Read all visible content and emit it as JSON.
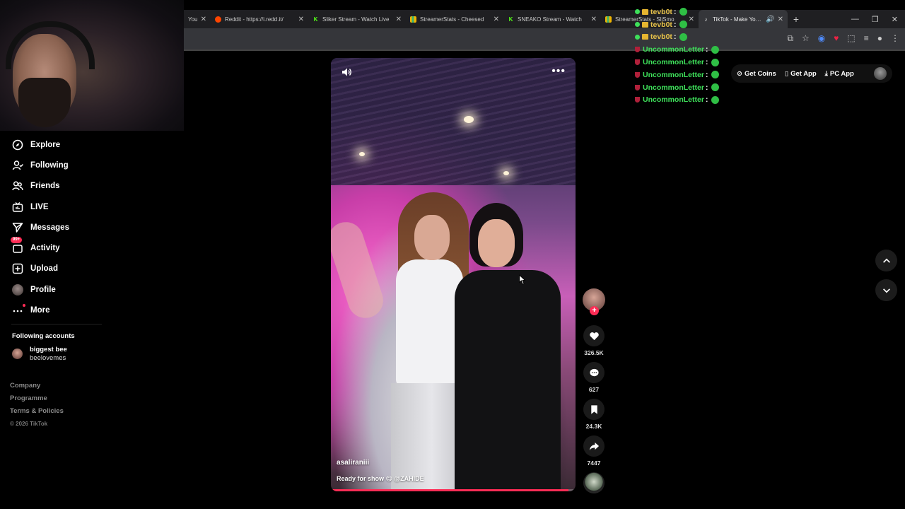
{
  "browser": {
    "tabs": [
      {
        "title": "You",
        "fav_color": "#ff0000",
        "fav_glyph": ""
      },
      {
        "title": "Reddit - https://i.redd.it/",
        "fav_color": "#ff4500",
        "fav_glyph": ""
      },
      {
        "title": "Sliker Stream - Watch Live",
        "fav_color": "#53fc18",
        "fav_glyph": "K"
      },
      {
        "title": "StreamerStats - Cheesed",
        "fav_color": "#f0b400",
        "fav_glyph": ""
      },
      {
        "title": "SNEAKO Stream - Watch",
        "fav_color": "#53fc18",
        "fav_glyph": "K"
      },
      {
        "title": "StreamerStats - SliSmo",
        "fav_color": "#f0b400",
        "fav_glyph": ""
      }
    ],
    "active_tab": "TikTok - Make Your Day"
  },
  "sidebar": {
    "items": [
      {
        "label": "Explore",
        "icon": "compass-icon"
      },
      {
        "label": "Following",
        "icon": "following-icon"
      },
      {
        "label": "Friends",
        "icon": "friends-icon"
      },
      {
        "label": "LIVE",
        "icon": "live-icon"
      },
      {
        "label": "Messages",
        "icon": "messages-icon"
      },
      {
        "label": "Activity",
        "icon": "activity-icon",
        "badge": "99+"
      },
      {
        "label": "Upload",
        "icon": "upload-icon"
      },
      {
        "label": "Profile",
        "icon": "profile-avatar"
      },
      {
        "label": "More",
        "icon": "more-icon"
      }
    ],
    "following_title": "Following accounts",
    "following": [
      {
        "name": "biggest bee",
        "username": "beelovemes"
      }
    ],
    "footer": [
      "Company",
      "Programme",
      "Terms & Policies"
    ],
    "copyright": "© 2026 TikTok"
  },
  "video": {
    "username": "asaliraniii",
    "caption": "Ready for show 😋 @ZAHIDE",
    "progress": 0.97
  },
  "actions": {
    "likes": "326.5K",
    "comments": "627",
    "saves": "24.3K",
    "shares": "7447"
  },
  "chat": [
    {
      "user": "tevb0t",
      "color": "yellow"
    },
    {
      "user": "tevb0t",
      "color": "yellow"
    },
    {
      "user": "tevb0t",
      "color": "yellow"
    },
    {
      "user": "UncommonLetter",
      "color": "green"
    },
    {
      "user": "UncommonLetter",
      "color": "green"
    },
    {
      "user": "UncommonLetter",
      "color": "green"
    },
    {
      "user": "UncommonLetter",
      "color": "green"
    },
    {
      "user": "UncommonLetter",
      "color": "green"
    }
  ],
  "header": {
    "get_coins": "Get Coins",
    "get_app": "Get App",
    "pc_app": "PC App"
  },
  "colors": {
    "accent": "#fe2c55",
    "chat_yellow": "#e8c34a",
    "chat_green": "#3ee05a"
  }
}
